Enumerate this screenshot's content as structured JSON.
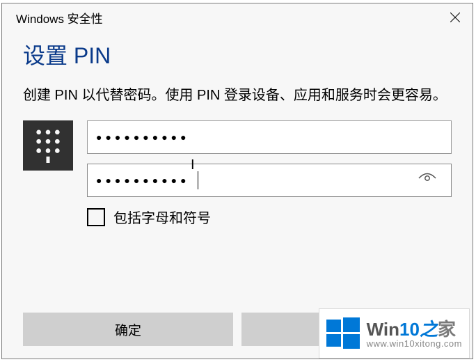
{
  "titlebar": {
    "title": "Windows 安全性"
  },
  "heading": "设置 PIN",
  "description": "创建 PIN 以代替密码。使用 PIN 登录设备、应用和服务时会更容易。",
  "fields": {
    "pin": {
      "mask": "●●●●●●●●●●"
    },
    "confirm": {
      "mask": "●●●●●●●●●●"
    }
  },
  "checkbox": {
    "label": "包括字母和符号",
    "checked": false
  },
  "buttons": {
    "ok": "确定",
    "cancel": ""
  },
  "watermark": {
    "brand_prefix": "Win",
    "brand_num": "10",
    "brand_zhi": "之",
    "brand_jia": "家",
    "url": "www.win10xitong.com"
  }
}
